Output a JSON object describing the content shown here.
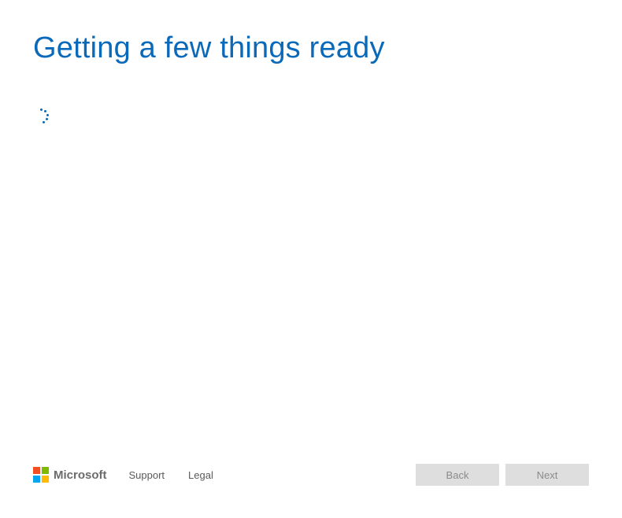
{
  "header": {
    "title": "Getting a few things ready"
  },
  "colors": {
    "accent": "#0b69b9"
  },
  "footer": {
    "brand": "Microsoft",
    "links": {
      "support": "Support",
      "legal": "Legal"
    },
    "buttons": {
      "back": "Back",
      "next": "Next"
    }
  }
}
